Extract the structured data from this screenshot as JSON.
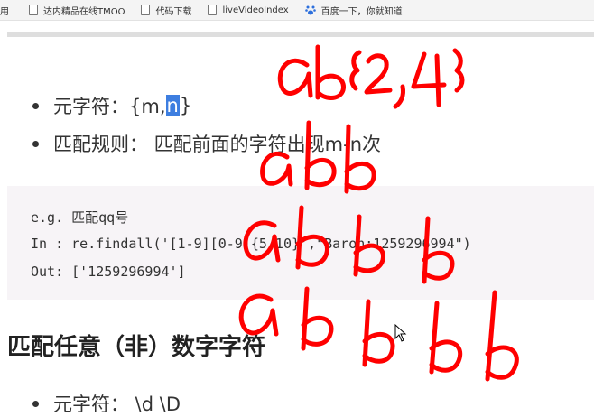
{
  "bookmarks": {
    "items": [
      {
        "label": "用",
        "icon": "none"
      },
      {
        "label": "达内精品在线TMOO",
        "icon": "doc-icon"
      },
      {
        "label": "代码下载",
        "icon": "doc-icon"
      },
      {
        "label": "liveVideoIndex",
        "icon": "doc-icon"
      },
      {
        "label": "百度一下，你就知道",
        "icon": "paw-icon"
      }
    ]
  },
  "content": {
    "bullet1_prefix": "元字符：{m,",
    "bullet1_highlight": "n",
    "bullet1_suffix": "}",
    "bullet2": "匹配规则： 匹配前面的字符出现m-n次",
    "code": [
      "e.g. 匹配qq号",
      "In : re.findall('[1-9][0-9]{5,10}',\"Baron:1259296994\")",
      "Out: ['1259296994']"
    ],
    "heading": "匹配任意（非）数字字符",
    "bullet3": "元字符： \\d \\D"
  },
  "annotations": {
    "ink_color": "#ff0000",
    "handwriting": [
      "ab{2,4}",
      "abb",
      "abbb",
      "abbbb"
    ]
  }
}
